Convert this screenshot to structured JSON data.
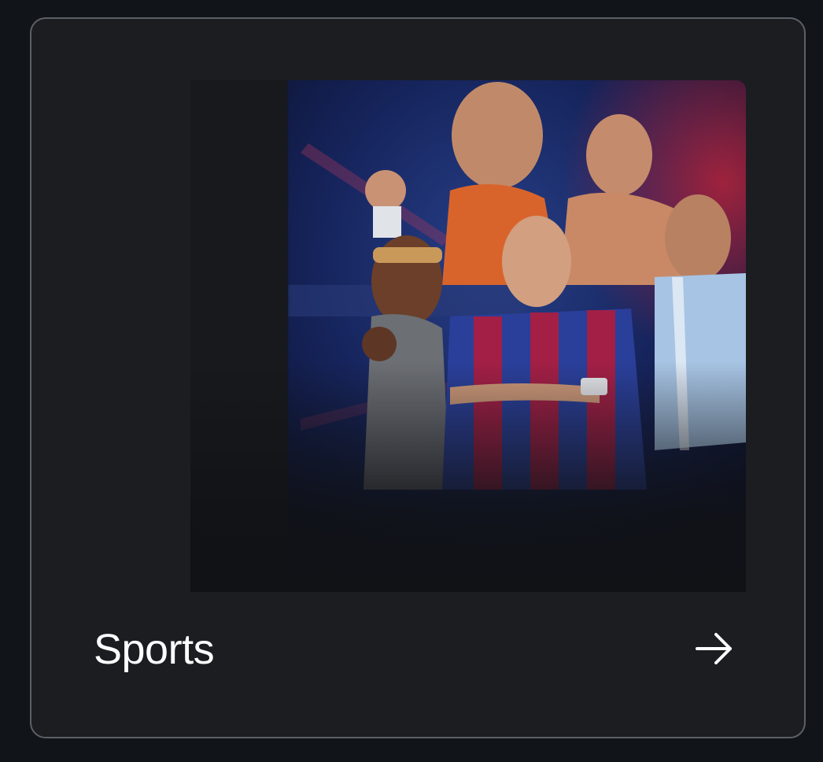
{
  "card": {
    "title": "Sports",
    "image_icon": "sports-stars-collage-image",
    "arrow_icon": "arrow-right-icon"
  },
  "theme": {
    "page_bg": "#111418",
    "card_bg": "#1b1d21",
    "card_border": "#5c6066",
    "text": "#ffffff"
  }
}
